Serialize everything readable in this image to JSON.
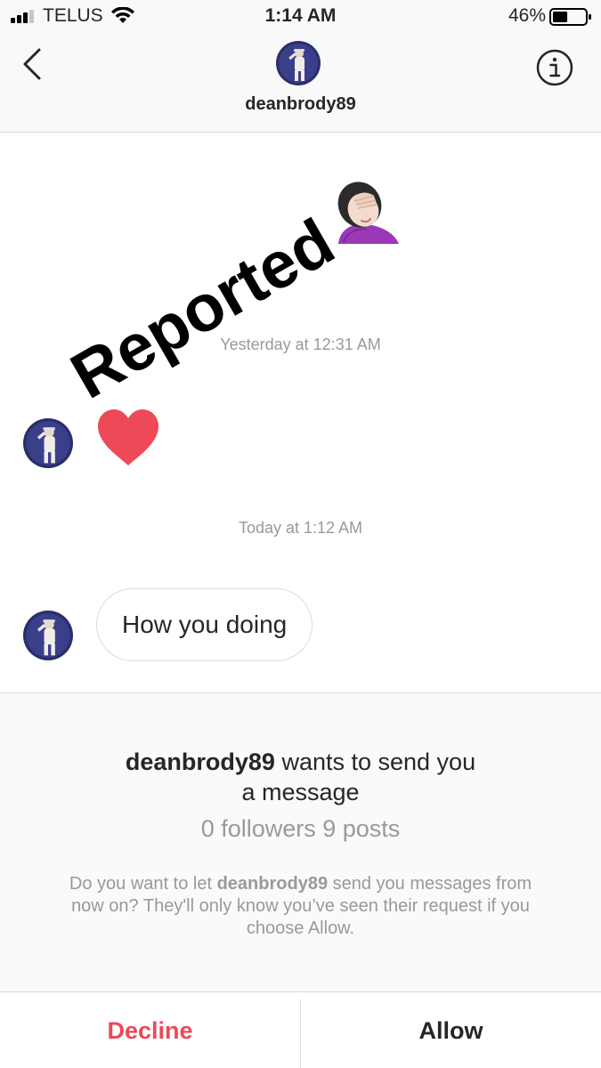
{
  "status_bar": {
    "carrier": "TELUS",
    "time": "1:14 AM",
    "battery_percent": "46%",
    "battery_level": 0.46,
    "signal_bars": 3
  },
  "header": {
    "username": "deanbrody89",
    "back_icon": "chevron-left-icon",
    "info_icon": "info-icon"
  },
  "chat": {
    "overlay_text": "Reported",
    "overlay_emoji": "facepalm-emoji",
    "messages": [
      {
        "timestamp": "Yesterday at 12:31 AM",
        "content": "heart-emoji"
      },
      {
        "timestamp": "Today at 1:12 AM",
        "text": "How you doing"
      }
    ]
  },
  "request": {
    "username": "deanbrody89",
    "title_suffix": " wants to send you",
    "title_line2": "a message",
    "stats": "0 followers 9 posts",
    "desc_prefix": "Do you want to let ",
    "desc_username": "deanbrody89",
    "desc_suffix": " send you messages from now on? They'll only know you’ve seen their request if you choose Allow."
  },
  "actions": {
    "decline_label": "Decline",
    "allow_label": "Allow",
    "decline_color": "#ed4956"
  }
}
